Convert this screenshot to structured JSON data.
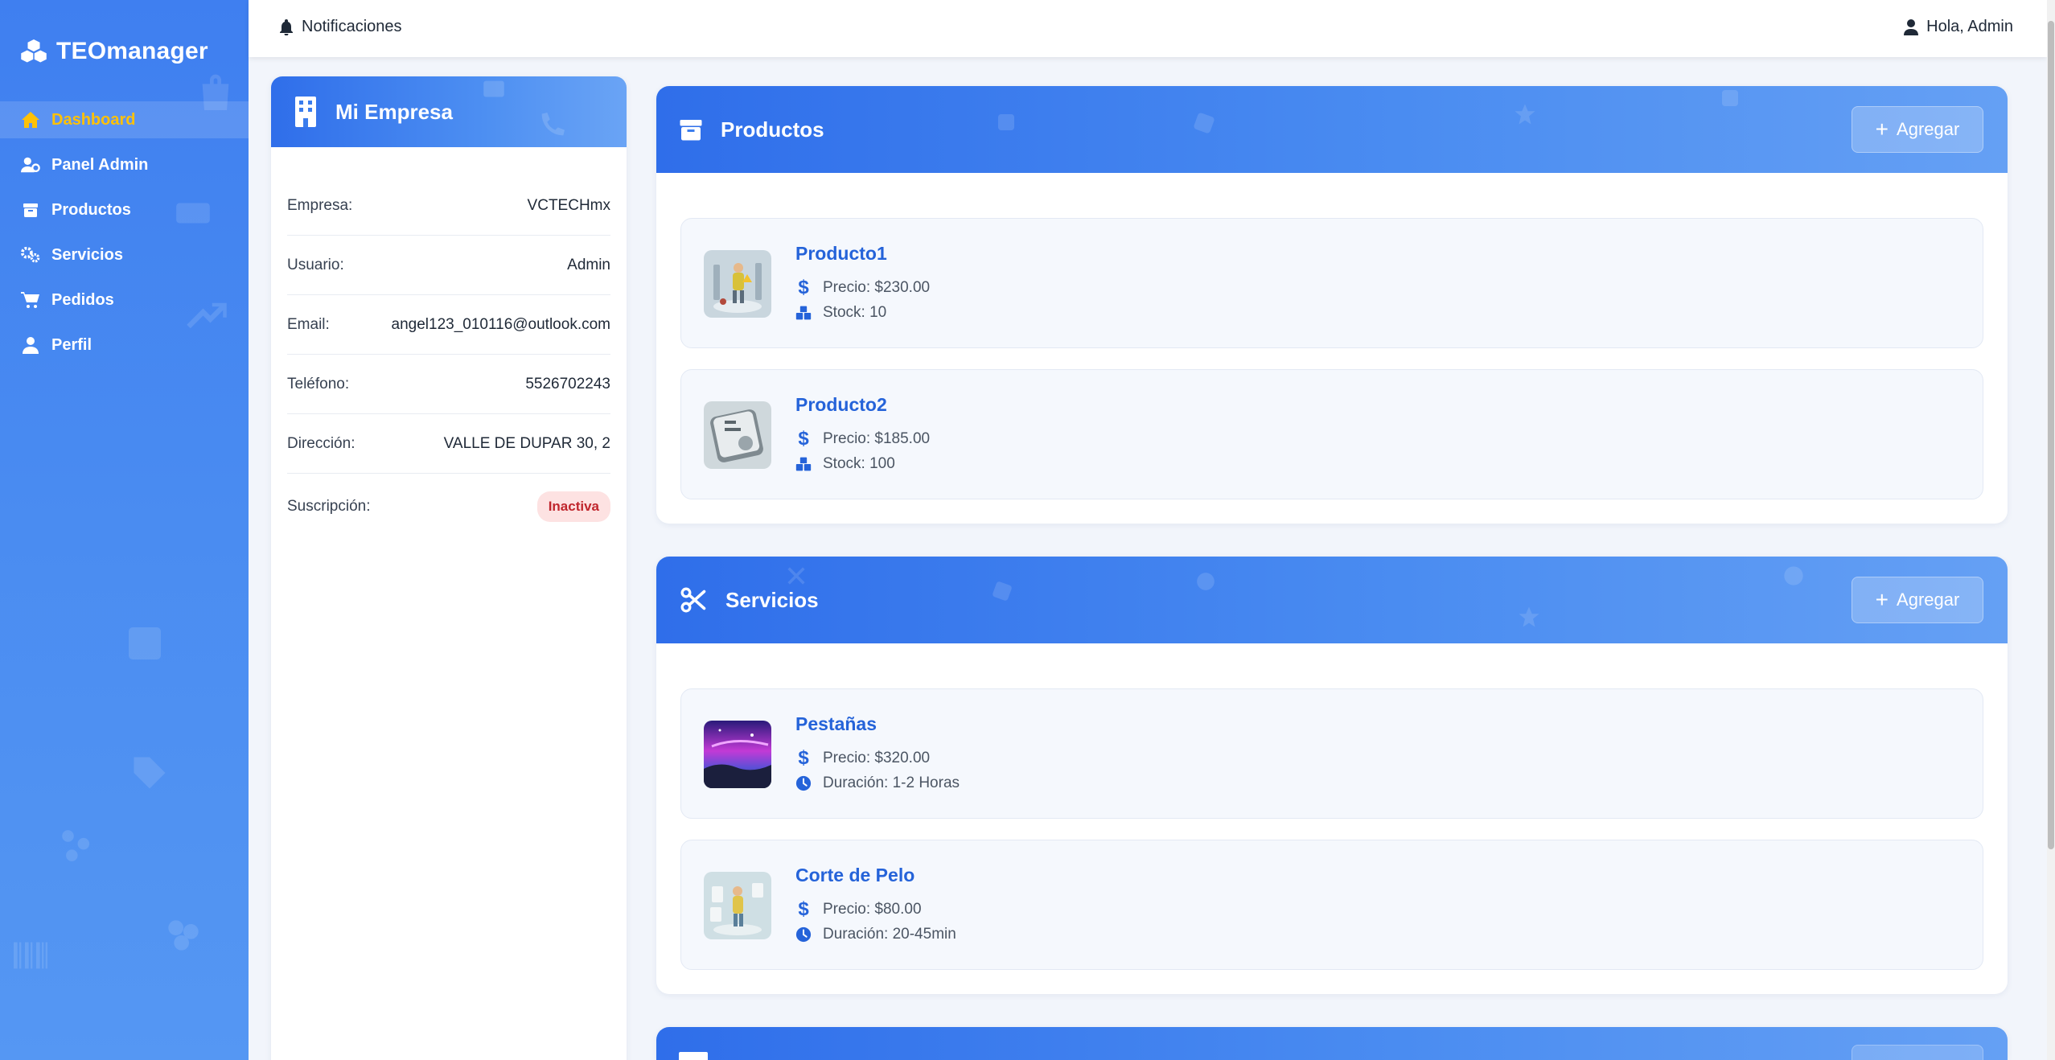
{
  "app": {
    "brand": "TEOmanager"
  },
  "sidebar": {
    "items": [
      {
        "label": "Dashboard",
        "icon": "home-icon",
        "active": true
      },
      {
        "label": "Panel Admin",
        "icon": "user-cog-icon"
      },
      {
        "label": "Productos",
        "icon": "box-icon"
      },
      {
        "label": "Servicios",
        "icon": "gears-icon"
      },
      {
        "label": "Pedidos",
        "icon": "cart-icon"
      },
      {
        "label": "Perfil",
        "icon": "user-icon"
      }
    ]
  },
  "topbar": {
    "notifications": "Notificaciones",
    "greeting": "Hola, Admin"
  },
  "company": {
    "title": "Mi Empresa",
    "rows": [
      {
        "label": "Empresa:",
        "value": "VCTECHmx"
      },
      {
        "label": "Usuario:",
        "value": "Admin"
      },
      {
        "label": "Email:",
        "value": "angel123_010116@outlook.com"
      },
      {
        "label": "Teléfono:",
        "value": "5526702243"
      },
      {
        "label": "Dirección:",
        "value": "VALLE DE DUPAR 30, 2"
      }
    ],
    "subscription_label": "Suscripción:",
    "subscription_status": "Inactiva"
  },
  "products": {
    "title": "Productos",
    "add_label": "Agregar",
    "items": [
      {
        "name": "Producto1",
        "price": "Precio: $230.00",
        "stock": "Stock: 10"
      },
      {
        "name": "Producto2",
        "price": "Precio: $185.00",
        "stock": "Stock: 100"
      }
    ]
  },
  "services": {
    "title": "Servicios",
    "add_label": "Agregar",
    "items": [
      {
        "name": "Pestañas",
        "price": "Precio: $320.00",
        "duration": "Duración: 1-2 Horas"
      },
      {
        "name": "Corte de Pelo",
        "price": "Precio: $80.00",
        "duration": "Duración: 20-45min"
      }
    ]
  },
  "colors": {
    "primary": "#3b7ded",
    "accent": "#ffc107",
    "danger": "#c0262d",
    "link": "#2563d9"
  }
}
